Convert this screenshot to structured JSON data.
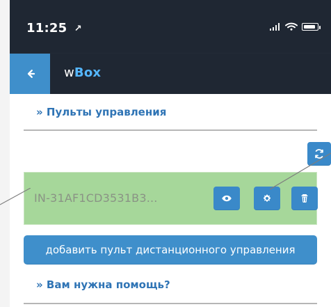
{
  "status": {
    "time": "11:25",
    "location_symbol": "↗"
  },
  "header": {
    "title_prefix": "w",
    "title_accent": "Box",
    "back_icon": "back-arrow-icon"
  },
  "sections": {
    "remote_controls": "» Пульты управления",
    "help": "» Вам нужна помощь?"
  },
  "device": {
    "id": "IN-31AF1CD3531B3..."
  },
  "actions": {
    "add_remote": "добавить пульт дистанционного управления"
  },
  "colors": {
    "top_bar": "#1f2733",
    "accent": "#3f8fcb",
    "title_accent": "#55b7ff",
    "link": "#2f74b5",
    "device_row": "#a6d79a",
    "divider": "#b6b6b6"
  },
  "icons": {
    "refresh": "refresh-icon",
    "view": "eye-icon",
    "settings": "gear-icon",
    "delete": "trash-icon"
  }
}
